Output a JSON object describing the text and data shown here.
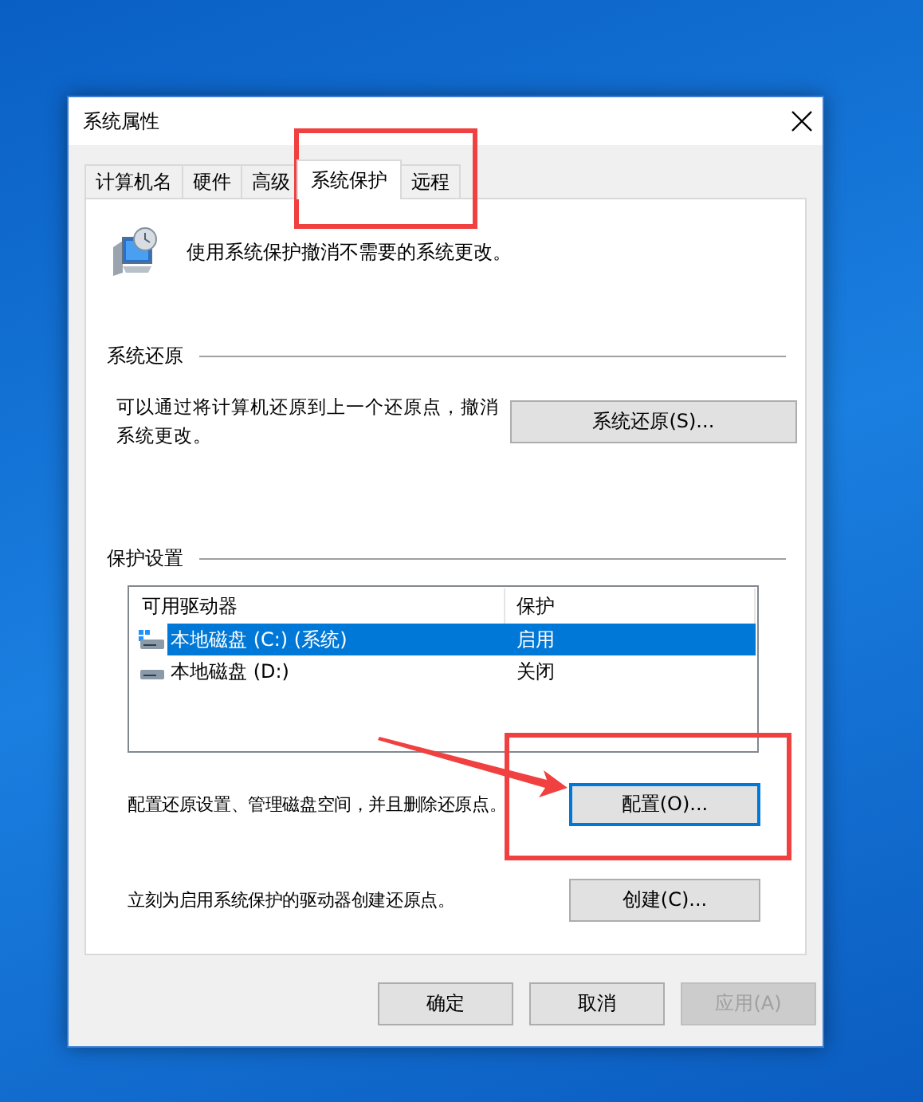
{
  "window": {
    "title": "系统属性"
  },
  "tabs": [
    {
      "label": "计算机名",
      "selected": false
    },
    {
      "label": "硬件",
      "selected": false
    },
    {
      "label": "高级",
      "selected": false
    },
    {
      "label": "系统保护",
      "selected": true
    },
    {
      "label": "远程",
      "selected": false
    }
  ],
  "intro": "使用系统保护撤消不需要的系统更改。",
  "restore": {
    "heading": "系统还原",
    "text": "可以通过将计算机还原到上一个还原点，撤消系统更改。",
    "button": "系统还原(S)..."
  },
  "protection": {
    "heading": "保护设置",
    "columns": [
      "可用驱动器",
      "保护"
    ],
    "rows": [
      {
        "kind": "system",
        "drive": "本地磁盘 (C:) (系统)",
        "protection": "启用",
        "selected": true
      },
      {
        "kind": "data",
        "drive": "本地磁盘 (D:)",
        "protection": "关闭",
        "selected": false
      }
    ],
    "actions": [
      {
        "text": "配置还原设置、管理磁盘空间，并且删除还原点。",
        "button": "配置(O)...",
        "focused": true
      },
      {
        "text": "立刻为启用系统保护的驱动器创建还原点。",
        "button": "创建(C)...",
        "focused": false
      }
    ]
  },
  "buttons": [
    {
      "label": "确定",
      "disabled": false
    },
    {
      "label": "取消",
      "disabled": false
    },
    {
      "label": "应用(A)",
      "disabled": true
    }
  ]
}
